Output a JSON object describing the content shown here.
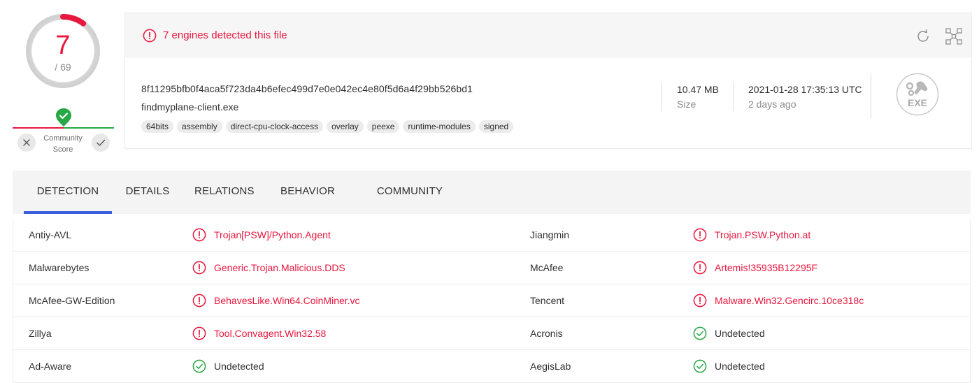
{
  "score": {
    "detected": "7",
    "total": "/ 69",
    "detected_value": 7,
    "total_value": 69,
    "community_label_line1": "Community",
    "community_label_line2": "Score"
  },
  "alert": {
    "text": "7 engines detected this file"
  },
  "file": {
    "hash": "8f11295bfb0f4aca5f723da4b6efec499d7e0e042ec4e80f5d6a4f29bb526bd1",
    "name": "findmyplane-client.exe",
    "tags": [
      "64bits",
      "assembly",
      "direct-cpu-clock-access",
      "overlay",
      "peexe",
      "runtime-modules",
      "signed"
    ],
    "size_value": "10.47 MB",
    "size_label": "Size",
    "date_value": "2021-01-28 17:35:13 UTC",
    "date_label": "2 days ago",
    "type_icon_text": "EXE"
  },
  "tabs": [
    {
      "label": "DETECTION",
      "active": true
    },
    {
      "label": "DETAILS",
      "active": false
    },
    {
      "label": "RELATIONS",
      "active": false
    },
    {
      "label": "BEHAVIOR",
      "active": false
    },
    {
      "label": "COMMUNITY",
      "active": false
    }
  ],
  "detections": [
    [
      {
        "engine": "Antiy-AVL",
        "result": "Trojan[PSW]/Python.Agent",
        "malicious": true
      },
      {
        "engine": "Jiangmin",
        "result": "Trojan.PSW.Python.at",
        "malicious": true
      }
    ],
    [
      {
        "engine": "Malwarebytes",
        "result": "Generic.Trojan.Malicious.DDS",
        "malicious": true
      },
      {
        "engine": "McAfee",
        "result": "Artemis!35935B12295F",
        "malicious": true
      }
    ],
    [
      {
        "engine": "McAfee-GW-Edition",
        "result": "BehavesLike.Win64.CoinMiner.vc",
        "malicious": true
      },
      {
        "engine": "Tencent",
        "result": "Malware.Win32.Gencirc.10ce318c",
        "malicious": true
      }
    ],
    [
      {
        "engine": "Zillya",
        "result": "Tool.Convagent.Win32.58",
        "malicious": true
      },
      {
        "engine": "Acronis",
        "result": "Undetected",
        "malicious": false
      }
    ],
    [
      {
        "engine": "Ad-Aware",
        "result": "Undetected",
        "malicious": false
      },
      {
        "engine": "AegisLab",
        "result": "Undetected",
        "malicious": false
      }
    ]
  ],
  "colors": {
    "malicious": "#e8173e",
    "clean": "#28a745",
    "accent": "#3a5fdd"
  }
}
